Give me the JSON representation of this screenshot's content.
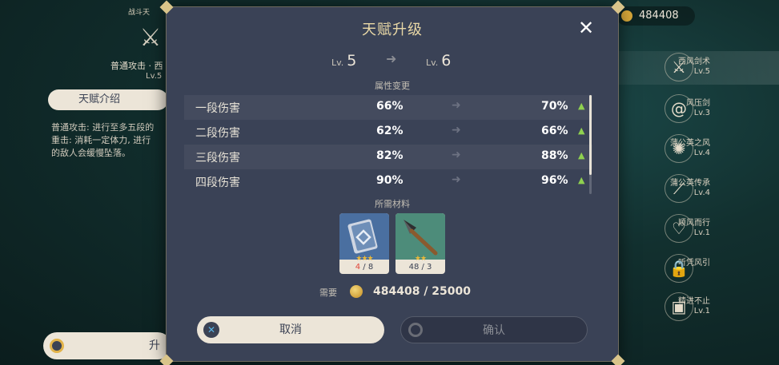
{
  "background_left": {
    "small_title": "战斗天",
    "skill_name": "普通攻击 · 西",
    "skill_level": "Lv.5",
    "tab_label": "天赋介绍",
    "description": "普通攻击: 进行至多五段的\n重击: 消耗一定体力, 进行\n的敌人会缓慢坠落。",
    "upgrade_label": "升"
  },
  "background_right": {
    "coins": "484408",
    "skills": [
      {
        "name": "西风剑术",
        "level": "Lv.5",
        "icon": "crossed-swords-icon"
      },
      {
        "name": "风压剑",
        "level": "Lv.3",
        "icon": "wind-swirl-icon"
      },
      {
        "name": "蒲公英之风",
        "level": "Lv.4",
        "icon": "dandelion-icon"
      },
      {
        "name": "蒲公英传承",
        "level": "Lv.4",
        "icon": "wind-slash-icon"
      },
      {
        "name": "顺风而行",
        "level": "Lv.1",
        "icon": "heart-wind-icon"
      },
      {
        "name": "听凭风引",
        "level": "",
        "icon": "lock-icon"
      },
      {
        "name": "精进不止",
        "level": "Lv.1",
        "icon": "card-alert-icon"
      }
    ]
  },
  "modal": {
    "title": "天赋升级",
    "level_prefix": "Lv.",
    "from_level": "5",
    "to_level": "6",
    "attributes_label": "属性变更",
    "attributes": [
      {
        "name": "一段伤害",
        "old": "66%",
        "new": "70%"
      },
      {
        "name": "二段伤害",
        "old": "62%",
        "new": "66%"
      },
      {
        "name": "三段伤害",
        "old": "82%",
        "new": "88%"
      },
      {
        "name": "四段伤害",
        "old": "90%",
        "new": "96%"
      }
    ],
    "materials_label": "所需材料",
    "materials": [
      {
        "name": "book",
        "stars": "★★★",
        "have": "4",
        "need": "8",
        "sufficient": false
      },
      {
        "name": "arrowhead",
        "stars": "★★",
        "have": "48",
        "need": "3",
        "sufficient": true
      }
    ],
    "cost_label": "需要",
    "cost_value": "484408 / 25000",
    "cancel_label": "取消",
    "confirm_label": "确认",
    "colors": {
      "accent_gold": "#e9d8a6",
      "increase_green": "#8fd14f",
      "panel": "#3a4256"
    }
  }
}
